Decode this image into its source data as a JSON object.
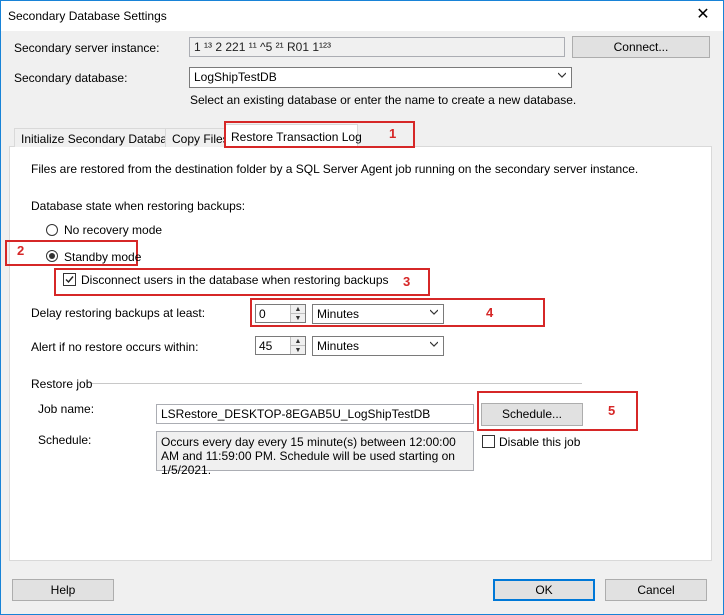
{
  "window": {
    "title": "Secondary Database Settings"
  },
  "server": {
    "label": "Secondary server instance:",
    "value": "1        ¹³ 2 221 ¹¹ ^5      ²¹  R01 1¹²³",
    "connect_label": "Connect..."
  },
  "database": {
    "label": "Secondary database:",
    "value": "LogShipTestDB",
    "hint": "Select an existing database or enter the name to create a new database."
  },
  "tabs": [
    {
      "label": "Initialize Secondary Database"
    },
    {
      "label": "Copy Files"
    },
    {
      "label": "Restore Transaction Log"
    }
  ],
  "restore": {
    "info": "Files are restored from the destination folder by a SQL Server Agent job running on the secondary server instance.",
    "state_label": "Database state when restoring backups:",
    "no_recovery_label": "No recovery mode",
    "standby_label": "Standby mode",
    "disconnect_label": "Disconnect users in the database when restoring backups",
    "delay_label": "Delay restoring backups at least:",
    "delay_value": "0",
    "delay_unit": "Minutes",
    "alert_label": "Alert if no restore occurs within:",
    "alert_value": "45",
    "alert_unit": "Minutes",
    "job_group": "Restore job",
    "job_name_label": "Job name:",
    "job_name_value": "LSRestore_DESKTOP-8EGAB5U_LogShipTestDB",
    "schedule_label": "Schedule:",
    "schedule_text": "Occurs every day every 15 minute(s) between 12:00:00 AM and 11:59:00 PM. Schedule will be used starting on 1/5/2021.",
    "schedule_button": "Schedule...",
    "disable_label": "Disable this job"
  },
  "annotations": [
    "1",
    "2",
    "3",
    "4",
    "5"
  ],
  "footer": {
    "help": "Help",
    "ok": "OK",
    "cancel": "Cancel"
  },
  "colors": {
    "annotation": "#d62727",
    "accent": "#0078d7"
  }
}
